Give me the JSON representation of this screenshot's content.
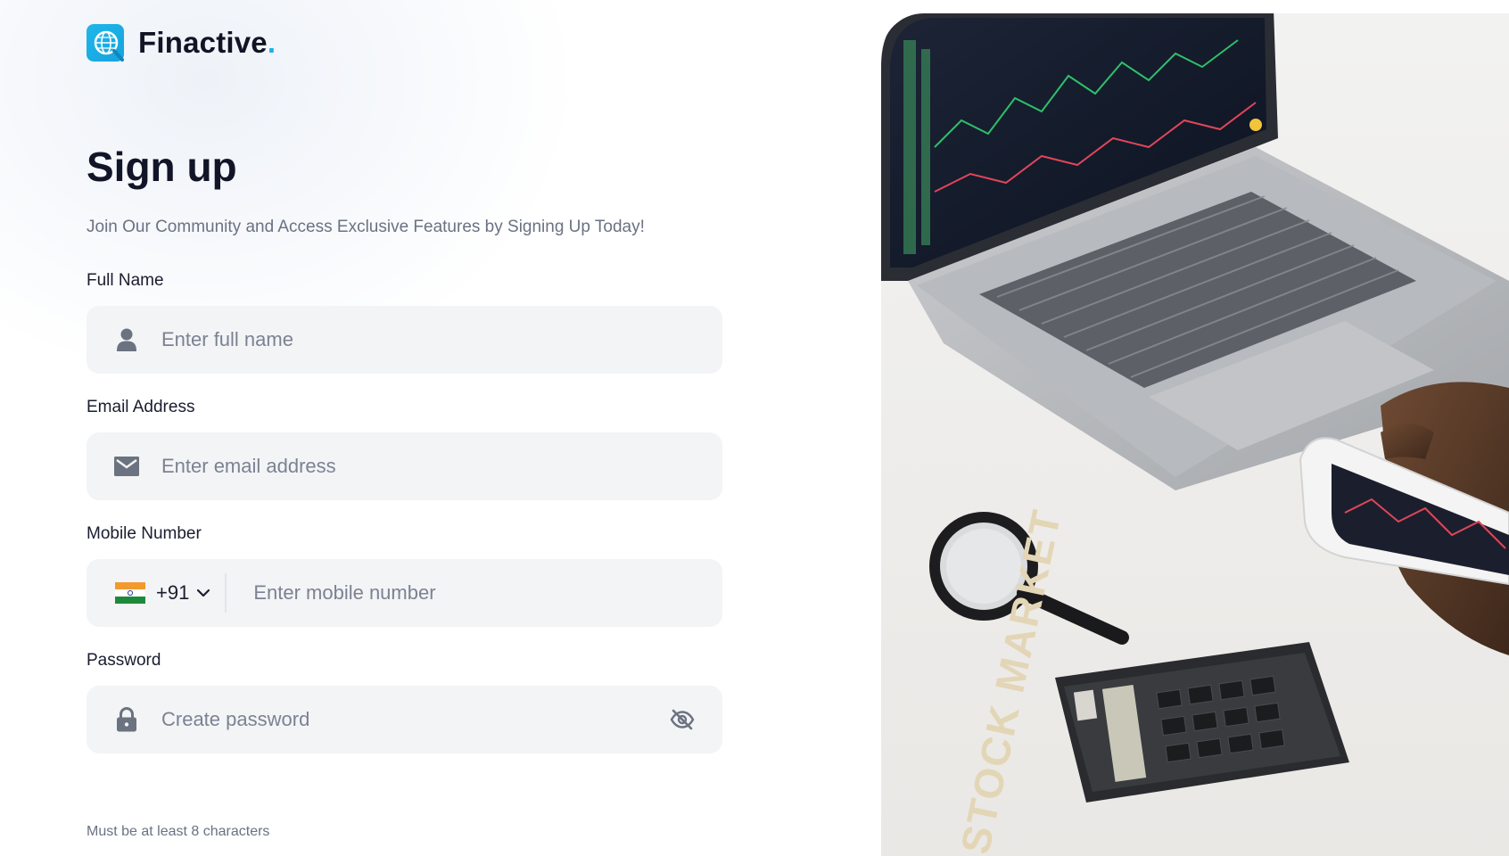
{
  "brand": {
    "name": "Finactive",
    "dot": ".",
    "accent": "#19b1e6"
  },
  "heading": {
    "title": "Sign up",
    "subtitle": "Join Our Community and Access Exclusive Features by Signing Up Today!"
  },
  "form": {
    "full_name": {
      "label": "Full Name",
      "placeholder": "Enter full name",
      "value": "",
      "icon": "user-icon"
    },
    "email": {
      "label": "Email Address",
      "placeholder": "Enter email address",
      "value": "",
      "icon": "mail-icon"
    },
    "mobile": {
      "label": "Mobile Number",
      "placeholder": "Enter mobile number",
      "value": "",
      "country_code": "+91",
      "country_flag": "india-flag-icon"
    },
    "password": {
      "label": "Password",
      "placeholder": "Create password",
      "value": "",
      "icon": "lock-icon",
      "toggle_icon": "eye-off-icon",
      "hint": "Must be at least 8 characters"
    }
  },
  "hero_image": {
    "alt": "Laptop with stock charts, magnifying glass, calculator and phone",
    "text_on_image": "STOCK MARKET"
  },
  "colors": {
    "field_bg": "#f3f4f6",
    "text_dark": "#121528",
    "text_muted": "#6a7283",
    "placeholder": "#7b8292",
    "icon": "#6b7280"
  }
}
